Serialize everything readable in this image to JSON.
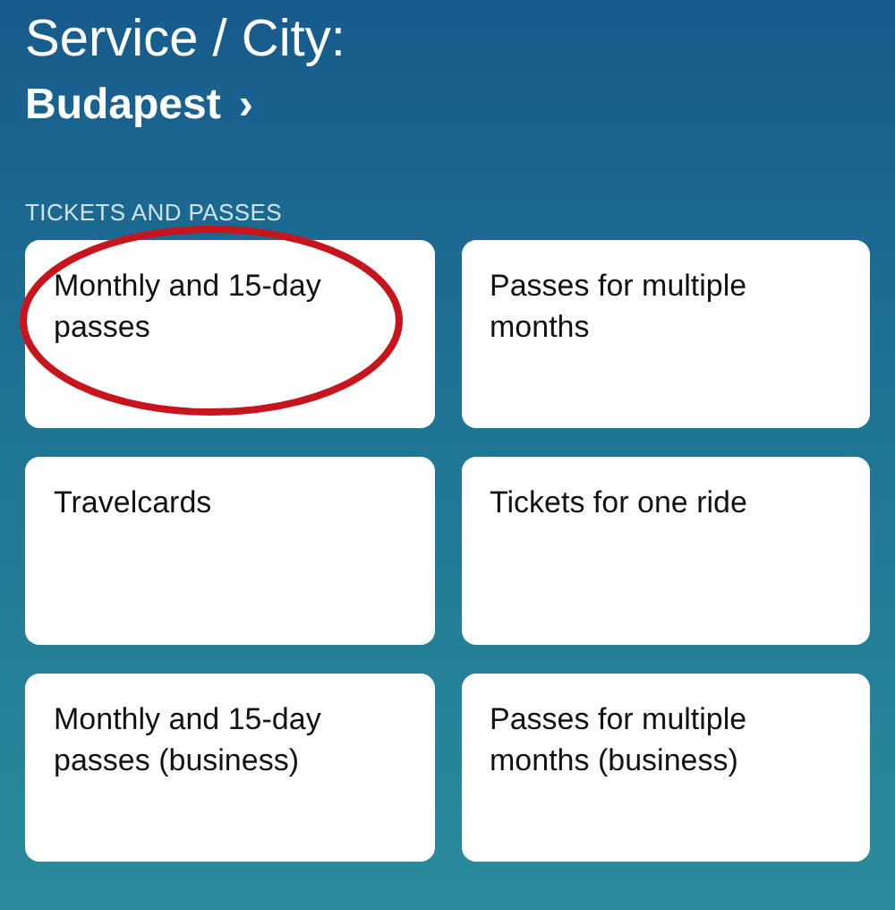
{
  "header": {
    "label": "Service / City:",
    "city": "Budapest",
    "chevron": "›"
  },
  "section": {
    "title": "TICKETS AND PASSES"
  },
  "cards": [
    {
      "label": "Monthly and 15-day passes",
      "circled": true
    },
    {
      "label": "Passes for multiple months",
      "circled": false
    },
    {
      "label": "Travelcards",
      "circled": false
    },
    {
      "label": "Tickets for one ride",
      "circled": false
    },
    {
      "label": "Monthly and 15-day passes (business)",
      "circled": false
    },
    {
      "label": "Passes for multiple months (business)",
      "circled": false
    }
  ]
}
